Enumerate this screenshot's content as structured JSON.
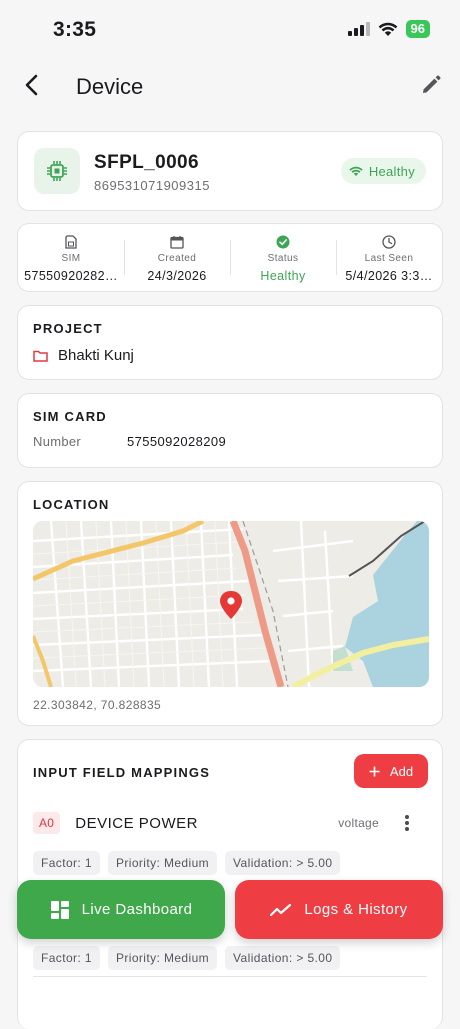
{
  "status_bar": {
    "time": "3:35",
    "battery": "96"
  },
  "header": {
    "title": "Device"
  },
  "device": {
    "name": "SFPL_0006",
    "id": "869531071909315",
    "health": "Healthy"
  },
  "stats": [
    {
      "label": "SIM",
      "value": "57550920282…"
    },
    {
      "label": "Created",
      "value": "24/3/2026"
    },
    {
      "label": "Status",
      "value": "Healthy"
    },
    {
      "label": "Last Seen",
      "value": "5/4/2026 3:3…"
    }
  ],
  "project": {
    "title": "PROJECT",
    "name": "Bhakti Kunj"
  },
  "sim_card": {
    "title": "SIM CARD",
    "number_label": "Number",
    "number_value": "5755092028209"
  },
  "location": {
    "title": "LOCATION",
    "coords": "22.303842, 70.828835"
  },
  "mappings": {
    "title": "INPUT FIELD MAPPINGS",
    "add_label": "Add",
    "items": [
      {
        "code": "A0",
        "name": "DEVICE POWER",
        "type": "voltage",
        "factor": "Factor: 1",
        "priority": "Priority: Medium",
        "validation": "Validation: > 5.00"
      },
      {
        "factor": "Factor: 1",
        "priority": "Priority: Medium",
        "validation": "Validation: > 5.00"
      }
    ]
  },
  "actions": {
    "live_dashboard": "Live Dashboard",
    "logs_history": "Logs & History"
  },
  "colors": {
    "green": "#3fa84a",
    "red": "#ef3d44",
    "background": "#f6f6f7"
  }
}
